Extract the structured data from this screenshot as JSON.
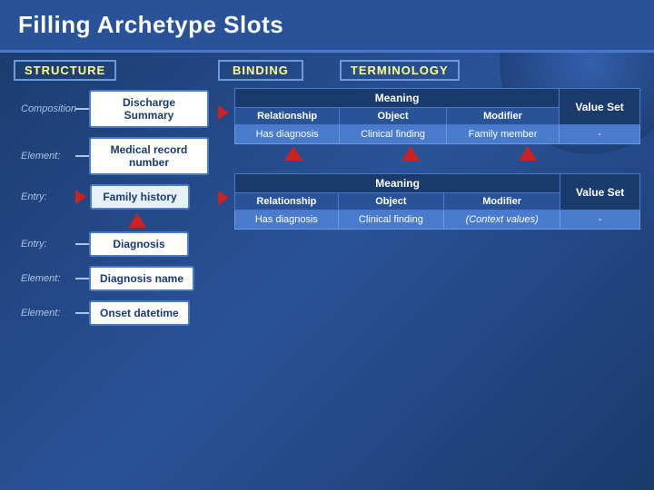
{
  "page": {
    "title": "Filling Archetype Slots",
    "bg_color": "#1a3a6b"
  },
  "columns": {
    "structure": "STRUCTURE",
    "binding": "BINDING",
    "terminology": "TERMINOLOGY"
  },
  "structure": {
    "composition_label": "Composition",
    "composition_box": "Discharge Summary",
    "element_label": "Element:",
    "element_box": "Medical record number",
    "entry_label": "Entry:",
    "entry_box": "Family history",
    "entry2_label": "Entry:",
    "entry2_box": "Diagnosis",
    "element2_label": "Element:",
    "element2_box": "Diagnosis name",
    "element3_label": "Element:",
    "element3_box": "Onset datetime"
  },
  "table1": {
    "meaning_label": "Meaning",
    "col1": "Relationship",
    "col2": "Object",
    "col3": "Modifier",
    "value_set_label": "Value Set",
    "row1_col1": "Has diagnosis",
    "row1_col2": "Clinical finding",
    "row1_col3": "Family member",
    "row1_value": "-"
  },
  "table2": {
    "meaning_label": "Meaning",
    "col1": "Relationship",
    "col2": "Object",
    "col3": "Modifier",
    "value_set_label": "Value Set",
    "row1_col1": "Has diagnosis",
    "row1_col2": "Clinical finding",
    "row1_col3": "(Context values)",
    "row1_value": "-"
  }
}
